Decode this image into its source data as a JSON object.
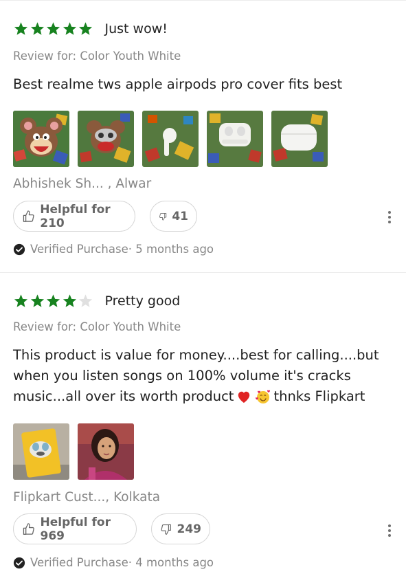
{
  "reviews": [
    {
      "rating": 5,
      "headline": "Just wow!",
      "review_for": "Review for: Color Youth White",
      "body": "Best realme tws apple airpods pro cover fits best",
      "author": "Abhishek Sh... , Alwar",
      "helpful_label": "Helpful for 210",
      "dislikes": "41",
      "verified": "Verified Purchase",
      "time": "· 5 months ago"
    },
    {
      "rating": 4,
      "headline": "Pretty good",
      "review_for": "Review for: Color Youth White",
      "body_line1": "This product is value for money....best for calling....but",
      "body_line2": "when you listen songs on 100% volume it's cracks",
      "body_line3a": "music...all over its worth product",
      "body_line3b": "thnks Flipkart",
      "author": "Flipkart Cust..., Kolkata",
      "helpful_label": "Helpful for 969",
      "dislikes": "249",
      "verified": "Verified Purchase",
      "time": "· 4 months ago"
    }
  ],
  "colors": {
    "star_green": "#17821f",
    "star_empty": "#e0e0e0",
    "muted": "#878787"
  },
  "icons": [
    "star-icon",
    "thumbs-up-icon",
    "thumbs-down-icon",
    "more-options-icon",
    "verified-check-icon",
    "heart-emoji-icon",
    "smiling-face-with-hearts-emoji-icon"
  ]
}
